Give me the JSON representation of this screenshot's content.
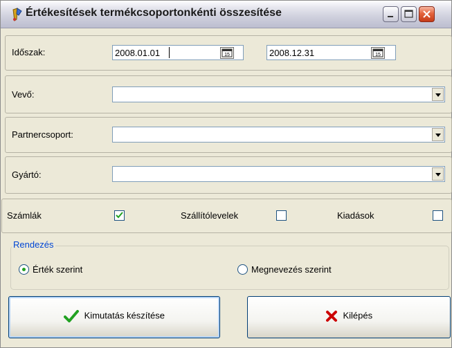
{
  "window": {
    "title": "Értékesítések termékcsoportonkénti összesítése",
    "icon": "app-icon"
  },
  "period": {
    "label": "Időszak:",
    "from_value": "2008.01.01",
    "to_value": "2008.12.31",
    "calendar_glyph": "15"
  },
  "fields": {
    "vevo_label": "Vevő:",
    "vevo_value": "",
    "partnercsoport_label": "Partnercsoport:",
    "partnercsoport_value": "",
    "gyarto_label": "Gyártó:",
    "gyarto_value": ""
  },
  "checks": {
    "szamlak_label": "Számlák",
    "szamlak_checked": true,
    "szallitolevelek_label": "Szállítólevelek",
    "szallitolevelek_checked": false,
    "kiadasok_label": "Kiadások",
    "kiadasok_checked": false
  },
  "sorting": {
    "legend": "Rendezés",
    "option_value_label": "Érték szerint",
    "option_name_label": "Megnevezés szerint",
    "selected": "value"
  },
  "buttons": {
    "create_label": "Kimutatás készítése",
    "exit_label": "Kilépés"
  },
  "colors": {
    "accent": "#0046d5",
    "check_green": "#21a121",
    "exit_red": "#cc0000"
  }
}
